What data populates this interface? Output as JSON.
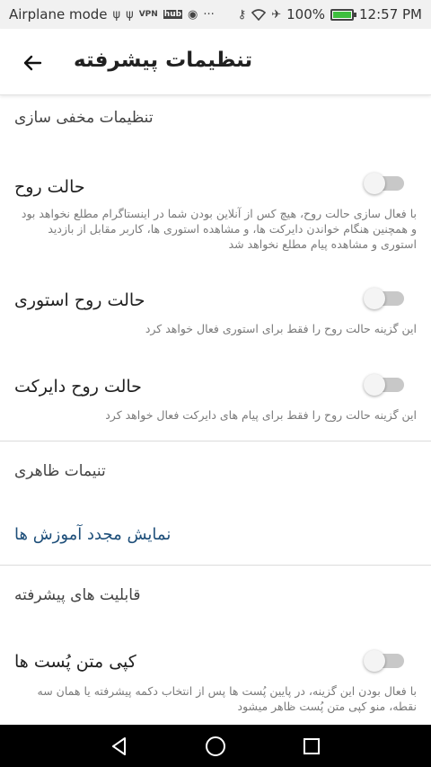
{
  "status_bar": {
    "left_text": "Airplane mode",
    "left_icons": [
      "usb-icon",
      "usb-icon",
      "vpn-icon",
      "hub-icon",
      "notification-icon",
      "more-icon"
    ],
    "battery_percent": "100%",
    "battery_level": 1.0,
    "time": "12:57 PM",
    "right_icons": [
      "key-icon",
      "wifi-icon",
      "airplane-icon",
      "battery-icon"
    ]
  },
  "toolbar": {
    "title": "تنظیمات پیشرفته",
    "back_icon": "arrow-back-icon"
  },
  "sections": {
    "hide": {
      "header": "تنظیمات مخفی سازی",
      "items": [
        {
          "title": "حالت روح",
          "desc": "با فعال سازی حالت روح، هیچ کس از آنلاین بودن شما در اینستاگرام مطلع نخواهد بود و همچنین هنگام خواندن دایرکت ها، و مشاهده استوری ها، کاربر مقابل از بازدید استوری و مشاهده پیام مطلع نخواهد شد",
          "enabled": false
        },
        {
          "title": "حالت روح استوری",
          "desc": "این گزینه حالت روح را فقط برای استوری فعال خواهد کرد",
          "enabled": false
        },
        {
          "title": "حالت روح دایرکت",
          "desc": "این گزینه حالت روح را فقط برای پیام های دایرکت فعال خواهد کرد",
          "enabled": false
        }
      ]
    },
    "appearance": {
      "header": "تنیمات ظاهری",
      "link": "نمایش مجدد آموزش ها"
    },
    "advanced": {
      "header": "قابلیت های پیشرفته",
      "items": [
        {
          "title": "کپی متن پُست ها",
          "desc": "با فعال بودن این گزینه، در پایین پُست ها پس از انتخاب دکمه پیشرفته یا همان سه نقطه، منو کپی متن پُست ظاهر میشود",
          "enabled": false
        }
      ]
    }
  },
  "nav": {
    "back": "nav-back-icon",
    "home": "nav-home-icon",
    "recents": "nav-recents-icon"
  }
}
